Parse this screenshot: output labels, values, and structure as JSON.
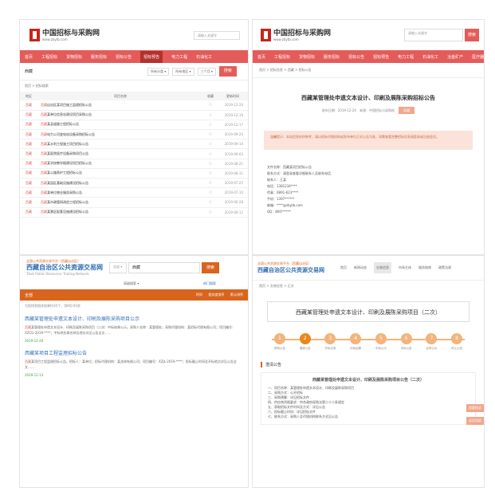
{
  "p1": {
    "logo_text": "中国招标与采购网",
    "logo_sub": "www.zbytb.com",
    "search_placeholder": "请输入关键字",
    "nav": [
      "首页",
      "工程招标",
      "货物招标",
      "服务招标",
      "招标公告",
      "招标预告",
      "电力工程",
      "石油化工"
    ],
    "keyword": "西藏",
    "filter1": "所有分类 ▾",
    "filter2": "所有地区 ▾",
    "filter3": "三个月 ▾",
    "search_btn": "搜索",
    "crumb": "首页 > 招标搜索",
    "columns": [
      "地区",
      "项目名称",
      "收藏",
      "更新时间"
    ],
    "rows": [
      {
        "region": "西藏",
        "kw": "西藏",
        "title": "自治区某项目施工监理招标公告",
        "date": "2019-12-20"
      },
      {
        "region": "西藏",
        "kw": "西藏",
        "title": "某单位信息化建设项目采购公告",
        "date": "2019-12-19"
      },
      {
        "region": "西藏",
        "kw": "西藏",
        "title": "某县道路工程招标公告",
        "date": "2019-12-17"
      },
      {
        "region": "西藏",
        "kw": "西藏",
        "title": "电力公司变电站设备采购招标公告",
        "date": "2019-09-24"
      },
      {
        "region": "西藏",
        "kw": "西藏",
        "title": "某水利工程施工项目招标公告",
        "date": "2019-09-14"
      },
      {
        "region": "西藏",
        "kw": "西藏",
        "title": "某医院医疗设备采购项目公告",
        "date": "2019-09-03"
      },
      {
        "region": "西藏",
        "kw": "西藏",
        "title": "某学校教学楼建设项目招标公告",
        "date": "2019-08-21"
      },
      {
        "region": "西藏",
        "kw": "西藏",
        "title": "某公路养护工程招标公告",
        "date": "2019-08-11"
      },
      {
        "region": "西藏",
        "kw": "西藏",
        "title": "某园区基础设施建设招标公告",
        "date": "2019-07-25"
      },
      {
        "region": "西藏",
        "kw": "西藏",
        "title": "某单位物业服务采购公告",
        "date": "2019-07-10"
      },
      {
        "region": "西藏",
        "kw": "西藏",
        "title": "某市政管网改造工程招标公告",
        "date": "2019-06-28"
      },
      {
        "region": "西藏",
        "kw": "西藏",
        "title": "某景区配套设施建设招标公告",
        "date": "2019-06-12"
      }
    ]
  },
  "p2": {
    "logo_text": "中国招标与采购网",
    "logo_sub": "www.zbytb.com",
    "search_placeholder": "请输入关键字",
    "search_btn": "搜索",
    "nav": [
      "首页",
      "工程招标",
      "货物招标",
      "服务招标",
      "招标公告",
      "招标预告",
      "电力工程",
      "石油化工",
      "冶金矿产",
      "医疗器械",
      "机械设备"
    ],
    "crumb": "首页 > 招标信息 > 西藏 > 招标公告",
    "title": "西藏某管理处申遗文本设计、印刷及展陈采购招标公告",
    "meta": "发布日期：2019-12-20　来源：中国招标与采购网",
    "meta_btn": "收藏",
    "notice": "温馨提示：本站信息仅供参考，请以招标代理机构或发布单位正式公告为准，如需查看完整招标信息请登录或注册会员。",
    "contact": [
      "文件名称：西藏某项目招标公告",
      "联系方式：请登录查看详细联系人及联系电话",
      "联系人：王某",
      "电话：1381234****",
      "传真：0891-623****",
      "手机：1397******",
      "邮箱：****@zbytb.com",
      "QQ：800******"
    ]
  },
  "p3": {
    "logo_top": "全国公共资源交易平台（西藏自治区）",
    "logo_big": "西藏自治区公共资源交易网",
    "logo_en": "Tibet Public Resources Trading Network",
    "select": "全部 ▾",
    "keyword": "西藏",
    "search_btn": "搜索",
    "sub_left": "高级搜索 ▾",
    "sub_right": "热门搜索",
    "bar_left": "全部",
    "bar_right": [
      "时间",
      "相关度排序",
      "默认排序"
    ],
    "hint": "为您找到相关结果约35个，用时0.01秒",
    "results": [
      {
        "title": "西藏某管理处申遗文本设计、印刷及展陈采购项目公示",
        "body_kw": "西藏",
        "body": "某管理处申遗文本设计、印刷及展陈采购项目（二次）中标结果公示。采购人名称：某管理处；采购代理机构：某招标代理有限公司；项目编号：XZCG-2019-****；中标供应商名称及地址详见公告全文……",
        "date": "2019-12-20"
      },
      {
        "title": "西藏某项目工程监理招标公告",
        "body_kw": "西藏",
        "body": "某项目工程监理招标公告。招标人：某单位；招标代理机构：某咨询有限公司；项目编号：XZJL-2019-****；投标截止时间及开标地点详见公告全文……",
        "date": "2019-12-13"
      }
    ]
  },
  "p4": {
    "logo_top": "全国公共资源交易平台（西藏自治区）",
    "logo_big": "西藏自治区公共资源交易网",
    "tabs": [
      "首页",
      "新闻动态",
      "交易信息",
      "市场主体",
      "服务指南",
      "政策法规"
    ],
    "active_tab": 2,
    "crumb": "首页 > 交易信息 > 正文",
    "title": "西藏某管理处申遗文本设计、印刷及展陈采购项目（二次）",
    "steps": [
      {
        "n": "1",
        "label": "采购公告"
      },
      {
        "n": "2",
        "label": "澄清公告"
      },
      {
        "n": "3",
        "label": "开标记录"
      },
      {
        "n": "4",
        "label": "评标结果"
      },
      {
        "n": "5",
        "label": "中标公示"
      },
      {
        "n": "6",
        "label": "中标公告"
      },
      {
        "n": "7",
        "label": "合同公示"
      },
      {
        "n": "8",
        "label": "终止公告"
      }
    ],
    "active_step": 1,
    "section": "澄清公告",
    "doc_title": "西藏某管理处申遗文本设计、印刷及展陈采购项目公告（二次）",
    "doc_lines": [
      "一、项目名称：某管理处申遗文本设计、印刷及展陈采购项目",
      "二、采购方式：公开招标",
      "三、采购预算：详见招标文件",
      "四、供应商资格要求：符合政府采购法第二十二条规定",
      "五、获取招标文件时间及方式：详见公告",
      "六、投标截止时间：详见招标文件",
      "七、联系方式：采购人及代理机构联系方式见公告"
    ],
    "side_tags": [
      "我要投诉",
      "返回顶部"
    ]
  }
}
